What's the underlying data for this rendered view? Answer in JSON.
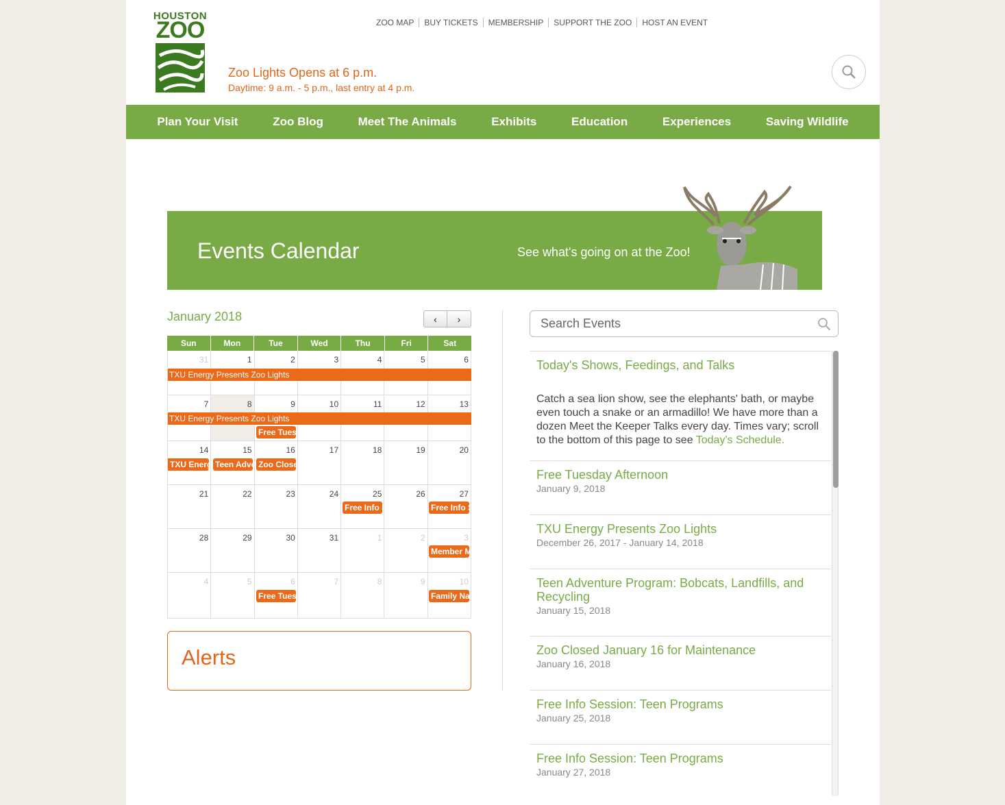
{
  "header": {
    "logo_line1": "HOUSTON",
    "logo_line2": "ZOO",
    "topnav": [
      "ZOO MAP",
      "BUY TICKETS",
      "MEMBERSHIP",
      "SUPPORT THE ZOO",
      "HOST AN EVENT"
    ],
    "hours_title": "Zoo Lights Opens at 6 p.m.",
    "hours_sub": "Daytime: 9 a.m. - 5 p.m., last entry at 4 p.m.",
    "brand_green": "#78ab46",
    "brand_orange": "#e0661a"
  },
  "mainnav": [
    "Plan Your Visit",
    "Zoo Blog",
    "Meet The Animals",
    "Exhibits",
    "Education",
    "Experiences",
    "Saving Wildlife"
  ],
  "banner": {
    "title": "Events Calendar",
    "subtitle": "See what's going on at the Zoo!"
  },
  "calendar": {
    "month": "January 2018",
    "prev_label": "‹",
    "next_label": "›",
    "weekdays": [
      "Sun",
      "Mon",
      "Tue",
      "Wed",
      "Thu",
      "Fri",
      "Sat"
    ],
    "weeks": [
      [
        "31",
        "1",
        "2",
        "3",
        "4",
        "5",
        "6"
      ],
      [
        "7",
        "8",
        "9",
        "10",
        "11",
        "12",
        "13"
      ],
      [
        "14",
        "15",
        "16",
        "17",
        "18",
        "19",
        "20"
      ],
      [
        "21",
        "22",
        "23",
        "24",
        "25",
        "26",
        "27"
      ],
      [
        "28",
        "29",
        "30",
        "31",
        "1",
        "2",
        "3"
      ],
      [
        "4",
        "5",
        "6",
        "7",
        "8",
        "9",
        "10"
      ]
    ],
    "events": {
      "zoo_lights": "TXU Energy Presents Zoo Lights",
      "free_tues": "Free Tuesday Afternoon",
      "txu_short": "TXU Energy Presents Zoo Lights",
      "teen_adv": "Teen Adventure Program",
      "zoo_closed": "Zoo Closed",
      "free_info": "Free Info Session",
      "member": "Member Morning",
      "family": "Family Nature"
    }
  },
  "alerts": {
    "title": "Alerts"
  },
  "search": {
    "placeholder": "Search Events"
  },
  "event_list": [
    {
      "title": "Today's Shows, Feedings, and Talks",
      "desc": "Catch a sea lion show, see the elephants' bath, or maybe even touch a snake or an armadillo! We have more than a dozen Meet the Keeper Talks every day. Times vary; scroll to the bottom of this page to see ",
      "link": "Today's Schedule."
    },
    {
      "title": "Free Tuesday Afternoon",
      "date": "January 9, 2018"
    },
    {
      "title": "TXU Energy Presents Zoo Lights",
      "date": "December 26, 2017 - January 14, 2018"
    },
    {
      "title": "Teen Adventure Program: Bobcats, Landfills, and Recycling",
      "date": "January 15, 2018"
    },
    {
      "title": "Zoo Closed January 16 for Maintenance",
      "date": "January 16, 2018"
    },
    {
      "title": "Free Info Session: Teen Programs",
      "date": "January 25, 2018"
    },
    {
      "title": "Free Info Session: Teen Programs",
      "date": "January 27, 2018"
    }
  ]
}
